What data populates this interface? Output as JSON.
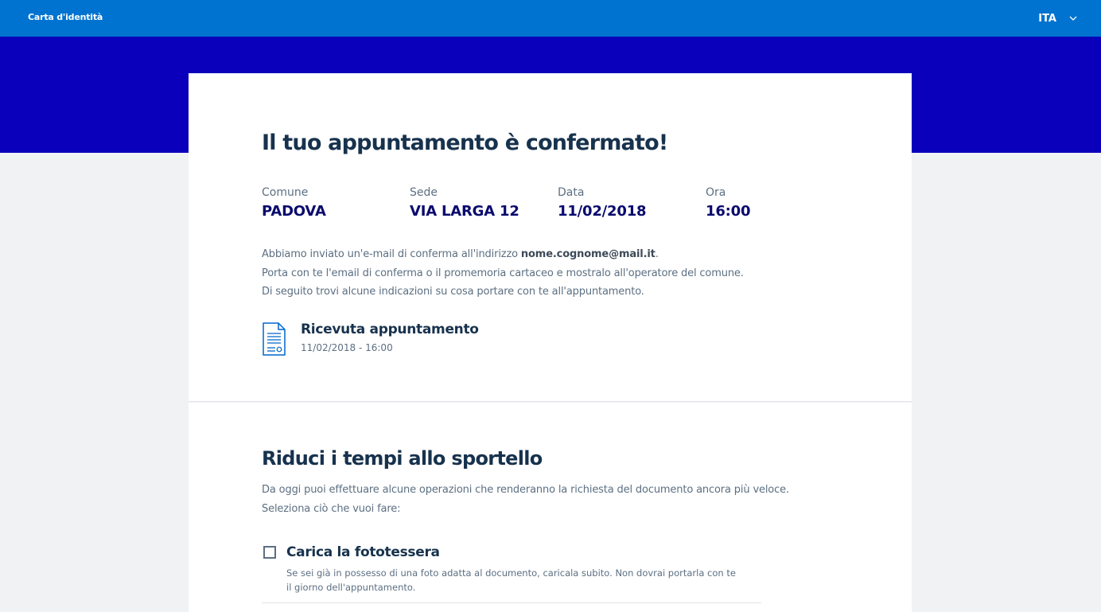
{
  "topbar": {
    "title": "Carta d'identità",
    "language": "ITA",
    "colors": {
      "bar": "#0073d0",
      "hero": "#0a00bb"
    }
  },
  "confirmation": {
    "heading": "Il tuo appuntamento è confermato!",
    "details": [
      {
        "label": "Comune",
        "value": "PADOVA"
      },
      {
        "label": "Sede",
        "value": "VIA LARGA 12"
      },
      {
        "label": "Data",
        "value": "11/02/2018"
      },
      {
        "label": "Ora",
        "value": "16:00"
      }
    ],
    "message": {
      "line1_before": "Abbiamo inviato un'e-mail di conferma all'indirizzo ",
      "email": "nome.cognome@mail.it",
      "line1_after": ".",
      "line2": "Porta con te l'email di conferma o il promemoria cartaceo e mostralo all'operatore del comune.",
      "line3": "Di seguito trovi alcune indicazioni su cosa portare con te all'appuntamento."
    },
    "receipt": {
      "icon": "document-icon",
      "title": "Ricevuta appuntamento",
      "subtitle": "11/02/2018 - 16:00"
    }
  },
  "reduce": {
    "heading": "Riduci i tempi allo sportello",
    "line1": "Da oggi puoi effettuare alcune operazioni che renderanno la richiesta del documento ancora più veloce.",
    "line2": "Seleziona ciò che vuoi fare:",
    "options": [
      {
        "title": "Carica la fototessera",
        "checked": false,
        "description": "Se sei già in possesso di una foto adatta al documento, caricala subito. Non dovrai portarla con te il giorno dell'appuntamento."
      }
    ]
  }
}
